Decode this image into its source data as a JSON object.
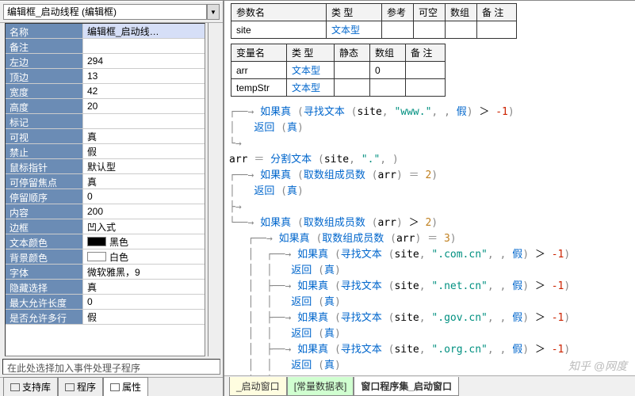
{
  "dropdown": {
    "value": "编辑框_启动线程 (编辑框)"
  },
  "props": [
    {
      "label": "名称",
      "value": "编辑框_启动线…",
      "selected": true
    },
    {
      "label": "备注",
      "value": ""
    },
    {
      "label": "左边",
      "value": "294"
    },
    {
      "label": "顶边",
      "value": "13"
    },
    {
      "label": "宽度",
      "value": "42"
    },
    {
      "label": "高度",
      "value": "20"
    },
    {
      "label": "标记",
      "value": ""
    },
    {
      "label": "可视",
      "value": "真"
    },
    {
      "label": "禁止",
      "value": "假"
    },
    {
      "label": "鼠标指针",
      "value": "默认型"
    },
    {
      "label": "可停留焦点",
      "value": "真"
    },
    {
      "label": "  停留顺序",
      "value": "0"
    },
    {
      "label": "内容",
      "value": "200"
    },
    {
      "label": "边框",
      "value": "凹入式"
    },
    {
      "label": "文本颜色",
      "value": "黑色",
      "swatch": "black"
    },
    {
      "label": "背景颜色",
      "value": "白色",
      "swatch": "white"
    },
    {
      "label": "字体",
      "value": "微软雅黑，9"
    },
    {
      "label": "隐藏选择",
      "value": "真"
    },
    {
      "label": "最大允许长度",
      "value": "0"
    },
    {
      "label": "是否允许多行",
      "value": "假"
    }
  ],
  "hint": "在此处选择加入事件处理子程序",
  "left_tabs": {
    "items": [
      "支持库",
      "程序",
      "属性"
    ],
    "active": 2
  },
  "param_table": {
    "headers": [
      "参数名",
      "类 型",
      "参考",
      "可空",
      "数组",
      "备 注"
    ],
    "rows": [
      {
        "name": "site",
        "type": "文本型"
      }
    ]
  },
  "var_table": {
    "headers": [
      "变量名",
      "类 型",
      "静态",
      "数组",
      "备 注"
    ],
    "rows": [
      {
        "name": "arr",
        "type": "文本型",
        "array": "0"
      },
      {
        "name": "tempStr",
        "type": "文本型",
        "array": ""
      }
    ]
  },
  "code": {
    "t": "as_shown"
  },
  "right_tabs": {
    "items": [
      "_启动窗口",
      "[常量数据表]",
      "窗口程序集_启动窗口"
    ],
    "active": 2
  },
  "watermark": "知乎 @网度"
}
